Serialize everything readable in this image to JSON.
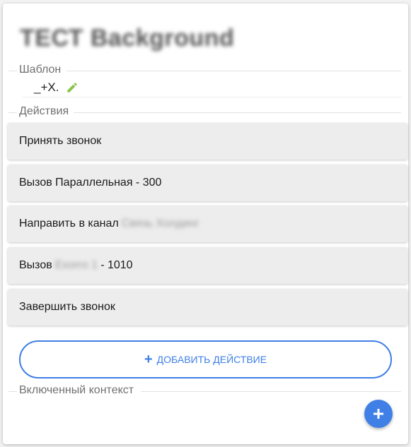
{
  "title": "ТЕСТ Background",
  "template": {
    "label": "Шаблон",
    "value": "_+X.",
    "edit_icon": "pencil-icon",
    "edit_icon_color": "#8bc34a"
  },
  "actions": {
    "label": "Действия",
    "items": [
      {
        "label": "Принять звонок"
      },
      {
        "label": "Вызов Параллельная - 300"
      },
      {
        "label": "Направить в канал",
        "hidden": "Связь Холдинг"
      },
      {
        "label": "Вызов",
        "hidden": "Exorro 1",
        "suffix": "- 1010"
      },
      {
        "label": "Завершить звонок"
      }
    ]
  },
  "add_action_button": {
    "label": "ДОБАВИТЬ ДЕЙСТВИЕ",
    "icon": "plus-icon"
  },
  "context": {
    "label": "Включенный контекст"
  },
  "fab": {
    "icon": "plus-icon"
  },
  "colors": {
    "accent": "#3f7fe6",
    "action_bg": "#ededed"
  }
}
